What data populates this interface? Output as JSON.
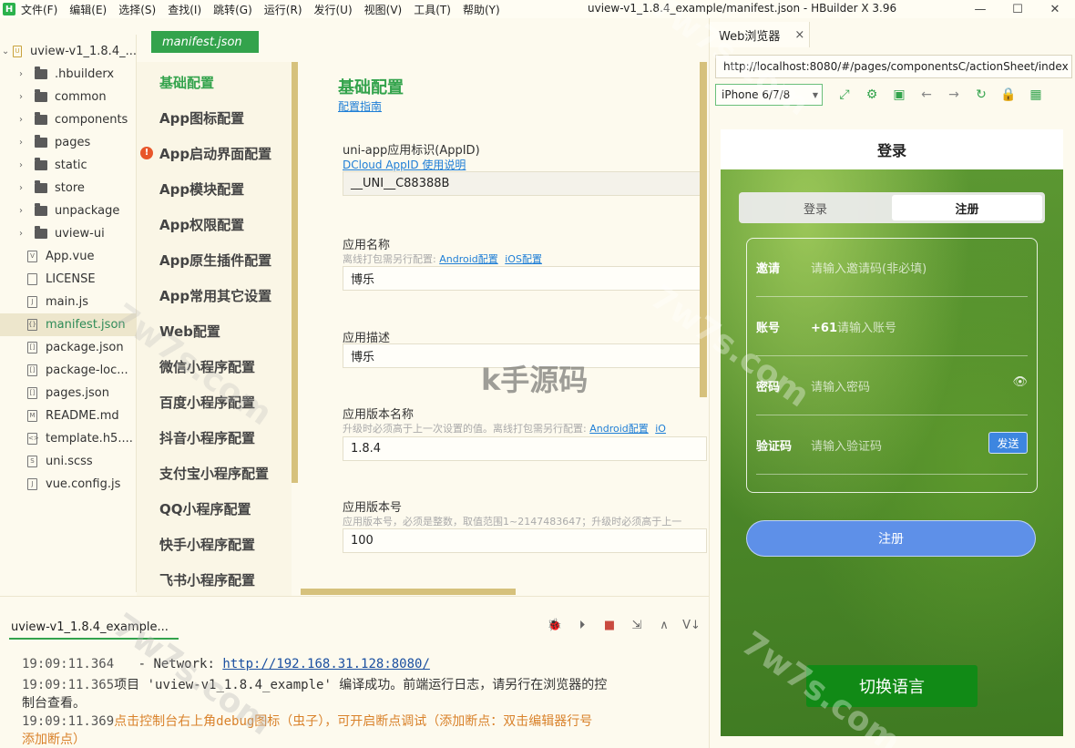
{
  "window": {
    "title": "uview-v1_1.8.4_example/manifest.json - HBuilder X 3.96",
    "logo_letter": "H",
    "controls": [
      "—",
      "☐",
      "✕"
    ]
  },
  "menu": [
    "文件(F)",
    "编辑(E)",
    "选择(S)",
    "查找(I)",
    "跳转(G)",
    "运行(R)",
    "发行(U)",
    "视图(V)",
    "工具(T)",
    "帮助(Y)"
  ],
  "explorer": {
    "project": "uview-v1_1.8.4_...",
    "items": [
      {
        "name": ".hbuilderx",
        "type": "folder"
      },
      {
        "name": "common",
        "type": "folder"
      },
      {
        "name": "components",
        "type": "folder"
      },
      {
        "name": "pages",
        "type": "folder"
      },
      {
        "name": "static",
        "type": "folder"
      },
      {
        "name": "store",
        "type": "folder"
      },
      {
        "name": "unpackage",
        "type": "folder"
      },
      {
        "name": "uview-ui",
        "type": "folder"
      },
      {
        "name": "App.vue",
        "type": "file",
        "glyph": "V"
      },
      {
        "name": "LICENSE",
        "type": "file",
        "glyph": ""
      },
      {
        "name": "main.js",
        "type": "file",
        "glyph": "J"
      },
      {
        "name": "manifest.json",
        "type": "file",
        "glyph": "{}",
        "active": true
      },
      {
        "name": "package.json",
        "type": "file",
        "glyph": "[]"
      },
      {
        "name": "package-loc...",
        "type": "file",
        "glyph": "[]"
      },
      {
        "name": "pages.json",
        "type": "file",
        "glyph": "[]"
      },
      {
        "name": "README.md",
        "type": "file",
        "glyph": "M"
      },
      {
        "name": "template.h5....",
        "type": "file",
        "glyph": "<>"
      },
      {
        "name": "uni.scss",
        "type": "file",
        "glyph": "S"
      },
      {
        "name": "vue.config.js",
        "type": "file",
        "glyph": "J"
      }
    ],
    "tool_icons": [
      "☰",
      "⚙",
      "✲",
      "↻",
      "⌘"
    ]
  },
  "editor": {
    "tab_label": "manifest.json",
    "nav": [
      {
        "label": "基础配置",
        "active": true
      },
      {
        "label": "App图标配置"
      },
      {
        "label": "App启动界面配置",
        "warn": "!"
      },
      {
        "label": "App模块配置"
      },
      {
        "label": "App权限配置"
      },
      {
        "label": "App原生插件配置"
      },
      {
        "label": "App常用其它设置"
      },
      {
        "label": "Web配置"
      },
      {
        "label": "微信小程序配置"
      },
      {
        "label": "百度小程序配置"
      },
      {
        "label": "抖音小程序配置"
      },
      {
        "label": "支付宝小程序配置"
      },
      {
        "label": "QQ小程序配置"
      },
      {
        "label": "快手小程序配置"
      },
      {
        "label": "飞书小程序配置"
      }
    ],
    "content": {
      "title": "基础配置",
      "guide_link": "配置指南",
      "appid_label": "uni-app应用标识(AppID)",
      "appid_link": "DCloud AppID 使用说明",
      "appid_value": "__UNI__C88388B",
      "name_label": "应用名称",
      "name_hint": "离线打包需另行配置:",
      "name_link_android": "Android配置",
      "name_link_ios": "iOS配置",
      "name_value": "博乐",
      "desc_label": "应用描述",
      "desc_value": "博乐",
      "version_name_label": "应用版本名称",
      "version_name_hint": "升级时必须高于上一次设置的值。离线打包需另行配置:",
      "version_name_link_android": "Android配置",
      "version_name_link_ios": "iO",
      "version_name_value": "1.8.4",
      "version_code_label": "应用版本号",
      "version_code_hint": "应用版本号，必须是整数，取值范围1~2147483647；升级时必须高于上一",
      "version_code_value": "100"
    }
  },
  "watermark_center": "k手源码",
  "watermark_side": "7w7s.com",
  "console": {
    "tab": "uview-v1_1.8.4_example...",
    "tools": [
      "🐞",
      "⏵",
      "■",
      "⇲",
      "∧",
      "V↓"
    ],
    "lines": [
      {
        "ts": "19:09:11.364",
        "text": "- Network: ",
        "url": "http://192.168.31.128:8080/"
      },
      {
        "ts": "19:09:11.365",
        "text": "项目 'uview-v1_1.8.4_example' 编译成功。前端运行日志，请另行在浏览器的控"
      },
      {
        "ts": "",
        "text": "制台查看。"
      },
      {
        "ts": "19:09:11.369",
        "text": "点击控制台右上角debug图标（虫子），可开启断点调试（添加断点：双击编辑器行号",
        "warn": true
      },
      {
        "ts": "",
        "text": "添加断点）",
        "warn": true
      }
    ]
  },
  "browser": {
    "tab_label": "Web浏览器",
    "tab_close": "×",
    "url": "http://localhost:8080/#/pages/componentsC/actionSheet/index",
    "device": "iPhone 6/7/8",
    "device_arrow": "▼",
    "tool_icons": [
      "⤢",
      "⚙",
      "▣",
      "←",
      "→",
      "↻",
      "🔒",
      "▦"
    ]
  },
  "phone": {
    "header_title": "登录",
    "tabs": [
      "登录",
      "注册"
    ],
    "fields": [
      {
        "label": "邀请",
        "placeholder": "请输入邀请码(非必填)"
      },
      {
        "label": "账号",
        "prefix": "+61",
        "placeholder": "请输入账号"
      },
      {
        "label": "密码",
        "placeholder": "请输入密码",
        "eye": "👁"
      },
      {
        "label": "验证码",
        "placeholder": "请输入验证码",
        "action": "发送"
      }
    ],
    "submit_label": "注册",
    "lang_button": "切换语言"
  }
}
